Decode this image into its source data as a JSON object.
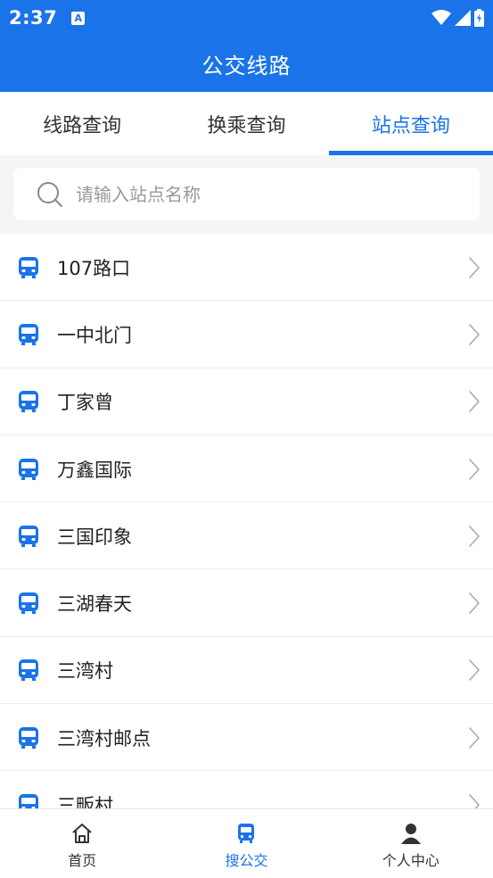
{
  "status": {
    "time": "2:37",
    "a_badge": "A"
  },
  "appbar": {
    "title": "公交线路"
  },
  "tabs": [
    {
      "label": "线路查询",
      "active": false
    },
    {
      "label": "换乘查询",
      "active": false
    },
    {
      "label": "站点查询",
      "active": true
    }
  ],
  "search": {
    "placeholder": "请输入站点名称",
    "value": ""
  },
  "stations": [
    "107路口",
    "一中北门",
    "丁家曾",
    "万鑫国际",
    "三国印象",
    "三湖春天",
    "三湾村",
    "三湾村邮点",
    "三畈村"
  ],
  "bottom_nav": [
    {
      "label": "首页",
      "icon": "home-icon",
      "active": false
    },
    {
      "label": "搜公交",
      "icon": "bus-icon",
      "active": true
    },
    {
      "label": "个人中心",
      "icon": "person-icon",
      "active": false
    }
  ],
  "colors": {
    "primary": "#1a73e8",
    "text": "#222222",
    "muted": "#999999"
  }
}
